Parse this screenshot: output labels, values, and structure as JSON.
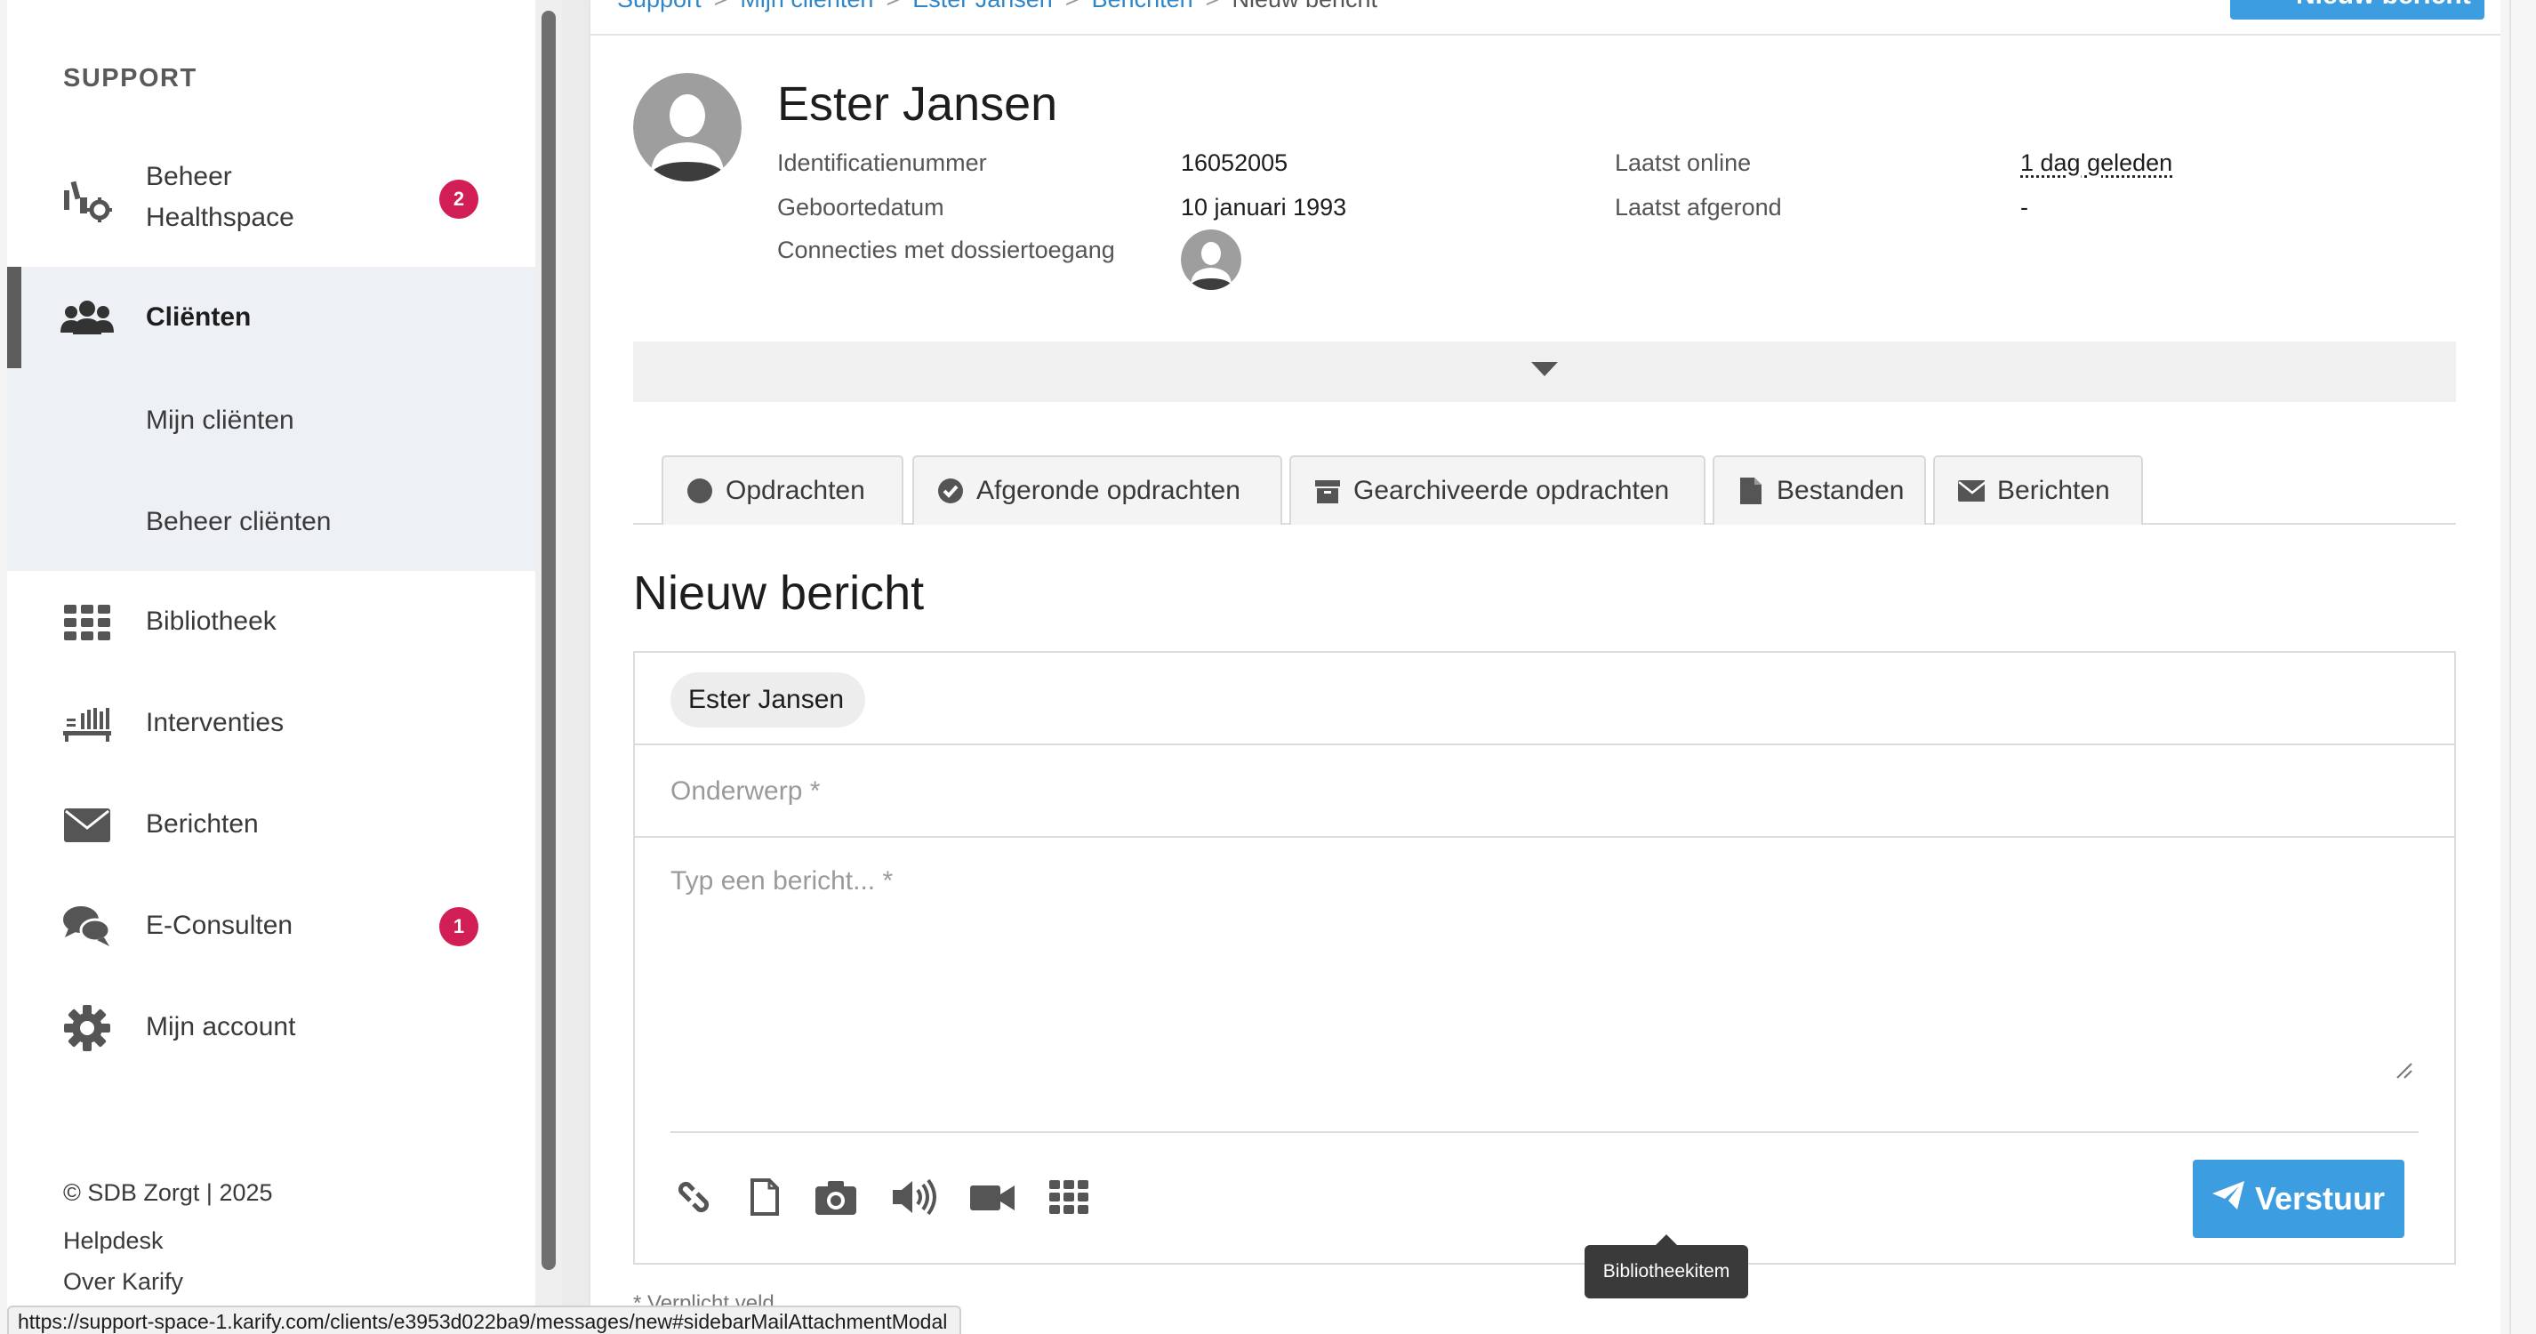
{
  "sidebar": {
    "space_title": "SUPPORT",
    "items": [
      {
        "label": "Beheer\nHealthspace",
        "icon": "healthspace-settings-icon",
        "badge": "2"
      },
      {
        "label": "Cliënten",
        "icon": "users-icon",
        "active": true
      },
      {
        "label": "Bibliotheek",
        "icon": "grid-icon"
      },
      {
        "label": "Interventies",
        "icon": "interventions-icon"
      },
      {
        "label": "Berichten",
        "icon": "envelope-icon"
      },
      {
        "label": "E-Consulten",
        "icon": "chat-bubbles-icon",
        "badge": "1"
      },
      {
        "label": "Mijn account",
        "icon": "gear-icon"
      }
    ],
    "sub_items": [
      {
        "label": "Mijn cliënten"
      },
      {
        "label": "Beheer cliënten"
      }
    ],
    "footer": {
      "copyright": "© SDB Zorgt | 2025",
      "links": [
        "Helpdesk",
        "Over Karify"
      ]
    }
  },
  "breadcrumb": [
    "Support",
    "Mijn cliënten",
    "Ester Jansen",
    "Berichten",
    "Nieuw bericht"
  ],
  "header_button": "Nieuw bericht",
  "client": {
    "name": "Ester Jansen",
    "fields": [
      {
        "label": "Identificatienummer",
        "value": "16052005"
      },
      {
        "label": "Geboortedatum",
        "value": "10 januari 1993"
      },
      {
        "label": "Connecties met dossiertoegang",
        "value": ""
      }
    ],
    "status": [
      {
        "label": "Laatst online",
        "value": "1 dag geleden"
      },
      {
        "label": "Laatst afgerond",
        "value": "-"
      }
    ]
  },
  "tabs": [
    {
      "label": "Opdrachten",
      "icon": "circle-icon"
    },
    {
      "label": "Afgeronde opdrachten",
      "icon": "check-circle-icon"
    },
    {
      "label": "Gearchiveerde opdrachten",
      "icon": "archive-icon"
    },
    {
      "label": "Bestanden",
      "icon": "file-icon"
    },
    {
      "label": "Berichten",
      "icon": "envelope-icon"
    }
  ],
  "compose": {
    "title": "Nieuw bericht",
    "recipient": "Ester Jansen",
    "subject_placeholder": "Onderwerp *",
    "body_placeholder": "Typ een bericht... *",
    "tools": [
      "link-icon",
      "file-icon",
      "camera-icon",
      "audio-icon",
      "video-icon",
      "library-grid-icon"
    ],
    "send_label": "Verstuur",
    "tooltip": "Bibliotheekitem",
    "required_note": "* Verplicht veld"
  },
  "status_url": "https://support-space-1.karify.com/clients/e3953d022ba9/messages/new#sidebarMailAttachmentModal",
  "colors": {
    "accent": "#3c9de0",
    "badge": "#d11e54",
    "active_bg": "#edf1f5"
  }
}
